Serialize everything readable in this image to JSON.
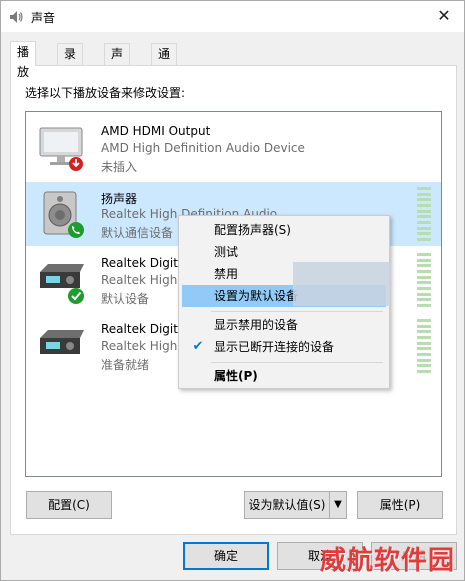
{
  "window": {
    "title": "声音",
    "close_glyph": "✕"
  },
  "tabs": [
    {
      "label": "播放",
      "active": true
    },
    {
      "label": "录制",
      "active": false
    },
    {
      "label": "声音",
      "active": false
    },
    {
      "label": "通信",
      "active": false
    }
  ],
  "panel": {
    "description": "选择以下播放设备来修改设置:"
  },
  "devices": [
    {
      "name": "AMD HDMI Output",
      "sub": "AMD High Definition Audio Device",
      "status": "未插入",
      "icon": "monitor-icon",
      "badge": "unplugged-badge-icon",
      "selected": false
    },
    {
      "name": "扬声器",
      "sub": "Realtek High Definition Audio",
      "status": "默认通信设备",
      "icon": "speaker-icon",
      "badge": "phone-badge-icon",
      "selected": true
    },
    {
      "name": "Realtek Digital",
      "sub": "Realtek High D",
      "status": "默认设备",
      "icon": "digital-receiver-icon",
      "badge": "default-check-badge-icon",
      "selected": false
    },
    {
      "name": "Realtek Digital",
      "sub": "Realtek High D",
      "status": "准备就绪",
      "icon": "digital-receiver-icon",
      "badge": "",
      "selected": false
    }
  ],
  "context_menu": {
    "items": [
      {
        "label": "配置扬声器(S)",
        "checked": false,
        "highlighted": false,
        "bold": false
      },
      {
        "label": "测试",
        "checked": false,
        "highlighted": false,
        "bold": false
      },
      {
        "label": "禁用",
        "checked": false,
        "highlighted": false,
        "bold": false
      },
      {
        "label": "设置为默认设备",
        "checked": false,
        "highlighted": true,
        "bold": false
      },
      {
        "label": "显示禁用的设备",
        "checked": false,
        "highlighted": false,
        "bold": false
      },
      {
        "label": "显示已断开连接的设备",
        "checked": true,
        "highlighted": false,
        "bold": false
      },
      {
        "label": "属性(P)",
        "checked": false,
        "highlighted": false,
        "bold": true
      }
    ]
  },
  "buttons": {
    "configure": "配置(C)",
    "set_default": "设为默认值(S)",
    "dropdown_glyph": "▼",
    "properties": "属性(P)",
    "ok": "确定",
    "cancel": "取消",
    "apply": "应用"
  },
  "watermark": "威航软件园",
  "colors": {
    "selection": "#cce8ff",
    "menu_highlight": "#91c9f7",
    "accent": "#0078d7",
    "ok_badge": "#1e9c2f",
    "unplugged_badge": "#d32020"
  }
}
